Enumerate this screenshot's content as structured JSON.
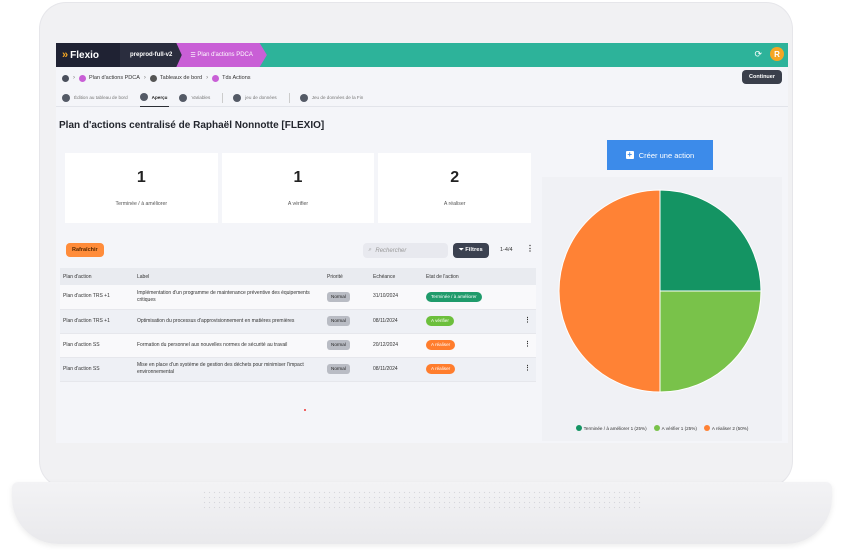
{
  "topbar": {
    "brand": "Flexio",
    "environment": "preprod-full-v2",
    "plan_tab": "Plan d'actions PDCA",
    "avatar_letter": "R",
    "color_brand_bar": "#2db39a",
    "color_plan_tab": "#c95fd6"
  },
  "breadcrumb": {
    "items": [
      "Plan d'actions PDCA",
      "Tableaux de bord",
      "Tds Actions"
    ],
    "continue_label": "Continuer"
  },
  "tabs": [
    {
      "label": "Édition au tableau de bord",
      "active": false
    },
    {
      "label": "Aperçu",
      "active": true
    },
    {
      "label": "Variables",
      "active": false
    },
    {
      "label": "jeu de données",
      "active": false
    },
    {
      "label": "Jeu de données de la Fin",
      "active": false
    }
  ],
  "page_title": "Plan d'actions centralisé de Raphaël Nonnotte [FLEXIO]",
  "kpis": [
    {
      "value": "1",
      "label": "Terminée / à améliorer"
    },
    {
      "value": "1",
      "label": "A vérifier"
    },
    {
      "value": "2",
      "label": "A réaliser"
    }
  ],
  "table": {
    "refresh_label": "Rafraîchir",
    "search_placeholder": "Rechercher",
    "filters_label": "Filtres",
    "pagination": "1-4/4",
    "columns": [
      "Plan d'action",
      "Label",
      "Priorité",
      "Echéance",
      "Etat de l'action"
    ],
    "rows": [
      {
        "plan": "Plan d'action TRS +1",
        "label": "Implémentation d'un programme de maintenance préventive des équipements critiques",
        "priority": "Normal",
        "due": "31/10/2024",
        "state": "Terminée / à améliorer",
        "state_color": "#1f9b6b"
      },
      {
        "plan": "Plan d'action TRS +1",
        "label": "Optimisation du processus d'approvisionnement en matières premières",
        "priority": "Normal",
        "due": "08/11/2024",
        "state": "A vérifier",
        "state_color": "#6cbf3c"
      },
      {
        "plan": "Plan d'action SS",
        "label": "Formation du personnel aux nouvelles normes de sécurité au travail",
        "priority": "Normal",
        "due": "20/12/2024",
        "state": "A réaliser",
        "state_color": "#ff7d2d"
      },
      {
        "plan": "Plan d'action SS",
        "label": "Mise en place d'un système de gestion des déchets pour minimiser l'impact environnemental",
        "priority": "Normal",
        "due": "08/11/2024",
        "state": "A réaliser",
        "state_color": "#ff7d2d"
      }
    ]
  },
  "create_action_label": "Créer une action",
  "chart_data": {
    "type": "pie",
    "title": "",
    "slices": [
      {
        "label": "Terminée / à améliorer 1 (25%)",
        "value": 1,
        "color": "#149463"
      },
      {
        "label": "A vérifier 1 (25%)",
        "value": 1,
        "color": "#79c24a"
      },
      {
        "label": "A réaliser 2 (50%)",
        "value": 2,
        "color": "#ff8235"
      }
    ],
    "legend_position": "bottom"
  }
}
